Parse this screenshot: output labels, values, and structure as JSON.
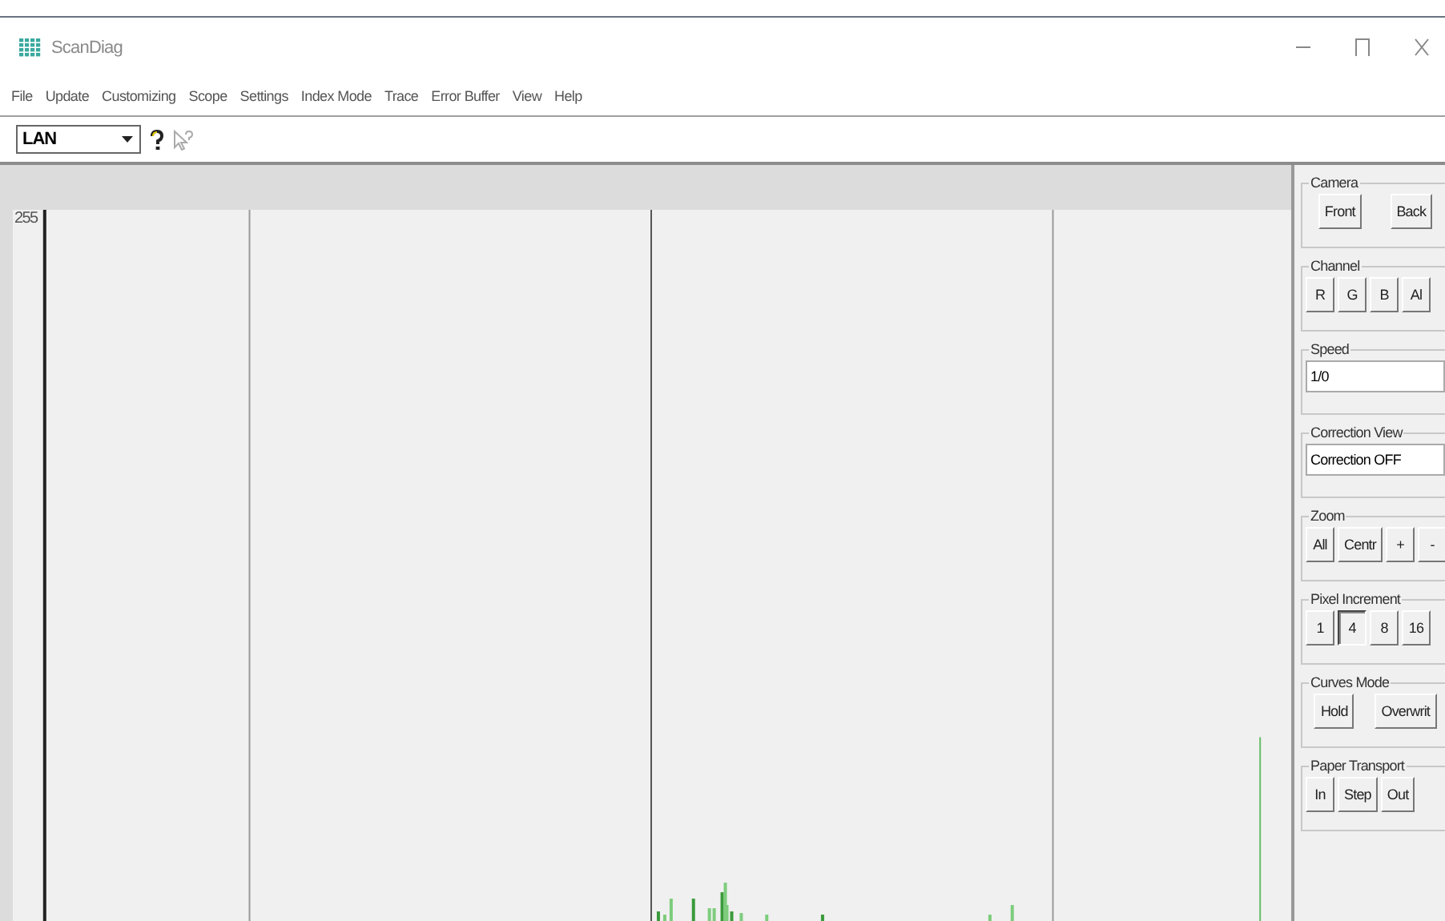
{
  "window": {
    "title": "ScanDiag"
  },
  "menu": [
    "File",
    "Update",
    "Customizing",
    "Scope",
    "Settings",
    "Index Mode",
    "Trace",
    "Error Buffer",
    "View",
    "Help"
  ],
  "toolbar": {
    "connection": {
      "value": "LAN"
    }
  },
  "plot": {
    "y_label": "255"
  },
  "panel": [
    {
      "title": "Camera",
      "kind": "buttons",
      "buttons": [
        {
          "label": "Front",
          "selected": false
        },
        {
          "label": "Back",
          "selected": false
        }
      ]
    },
    {
      "title": "Channel",
      "kind": "buttons",
      "buttons": [
        {
          "label": "R",
          "selected": false
        },
        {
          "label": "G",
          "selected": false
        },
        {
          "label": "B",
          "selected": false
        },
        {
          "label": "Al",
          "selected": false
        }
      ]
    },
    {
      "title": "Speed",
      "kind": "field",
      "value": "1/0"
    },
    {
      "title": "Correction View",
      "kind": "field",
      "value": "Correction OFF"
    },
    {
      "title": "Zoom",
      "kind": "buttons",
      "buttons": [
        {
          "label": "All",
          "selected": false
        },
        {
          "label": "Centr",
          "selected": false
        },
        {
          "label": "+",
          "selected": false
        },
        {
          "label": "-",
          "selected": false
        }
      ]
    },
    {
      "title": "Pixel Increment",
      "kind": "buttons",
      "buttons": [
        {
          "label": "1",
          "selected": false
        },
        {
          "label": "4",
          "selected": true
        },
        {
          "label": "8",
          "selected": false
        },
        {
          "label": "16",
          "selected": false
        }
      ]
    },
    {
      "title": "Curves Mode",
      "kind": "buttons",
      "buttons": [
        {
          "label": "Hold",
          "selected": false
        },
        {
          "label": "Overwrit",
          "selected": false
        }
      ]
    },
    {
      "title": "Paper Transport",
      "kind": "buttons",
      "buttons": [
        {
          "label": "In",
          "selected": false
        },
        {
          "label": "Step",
          "selected": false
        },
        {
          "label": "Out",
          "selected": false
        }
      ]
    }
  ]
}
